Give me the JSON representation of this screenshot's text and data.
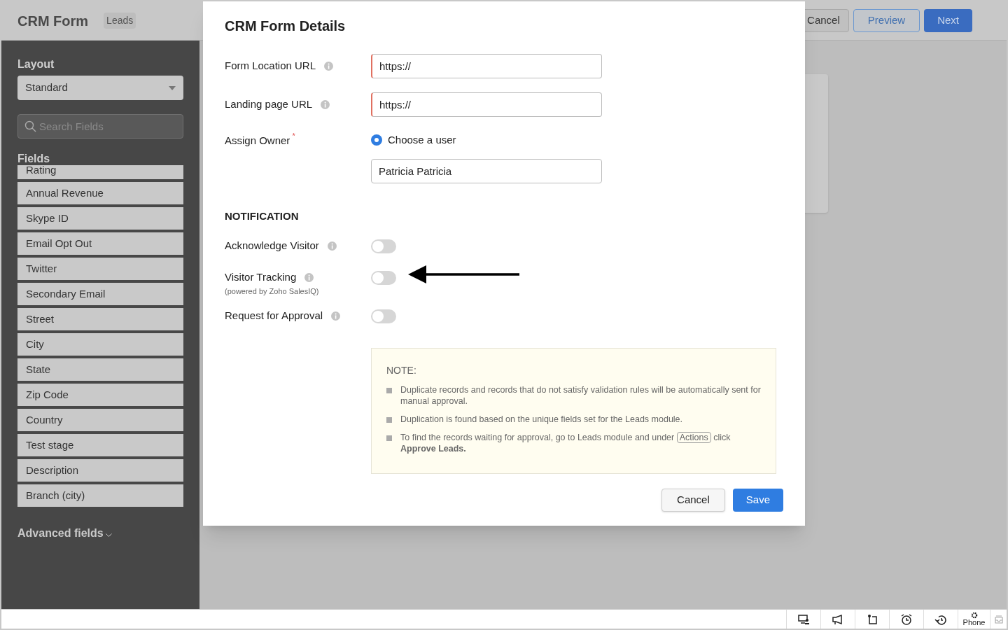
{
  "header": {
    "title": "CRM Form",
    "module": "Leads",
    "buttons": [
      {
        "label": "Cancel",
        "kind": "default"
      },
      {
        "label": "Preview",
        "kind": "outline"
      },
      {
        "label": "Next",
        "kind": "primary"
      }
    ]
  },
  "sidebar": {
    "layout_label": "Layout",
    "layout_value": "Standard",
    "search_placeholder": "Search Fields",
    "fields_label": "Fields",
    "fields": [
      "Rating",
      "Annual Revenue",
      "Skype ID",
      "Email Opt Out",
      "Twitter",
      "Secondary Email",
      "Street",
      "City",
      "State",
      "Zip Code",
      "Country",
      "Test stage",
      "Description",
      "Branch (city)"
    ],
    "advanced": "Advanced fields"
  },
  "dialog": {
    "title": "CRM Form Details",
    "url_fields": [
      {
        "label": "Form Location URL",
        "value": "https://"
      },
      {
        "label": "Landing page URL",
        "value": "https://"
      }
    ],
    "owner": {
      "label": "Assign Owner",
      "required_mark": "*",
      "option": "Choose a user",
      "selected": true,
      "value": "Patricia Patricia"
    },
    "notification_heading": "NOTIFICATION",
    "toggles": [
      {
        "label": "Acknowledge Visitor",
        "on": false
      },
      {
        "label": "Visitor Tracking",
        "note": "(powered by Zoho SalesIQ)",
        "on": false
      },
      {
        "label": "Request for Approval",
        "on": false
      }
    ],
    "note": {
      "heading": "NOTE:",
      "items": [
        {
          "text": "Duplicate records and records that do not satisfy validation rules will be automatically sent for manual approval."
        },
        {
          "text": "Duplication is found based on the unique fields set for the Leads module."
        },
        {
          "text": "To find the records waiting for approval, go to Leads module and under",
          "button": "Actions",
          "after": "click **Approve Leads.**"
        }
      ]
    },
    "buttons": [
      {
        "label": "Cancel",
        "kind": "default"
      },
      {
        "label": "Save",
        "kind": "primary"
      }
    ]
  },
  "footer": {
    "phone_label": "Phone"
  }
}
